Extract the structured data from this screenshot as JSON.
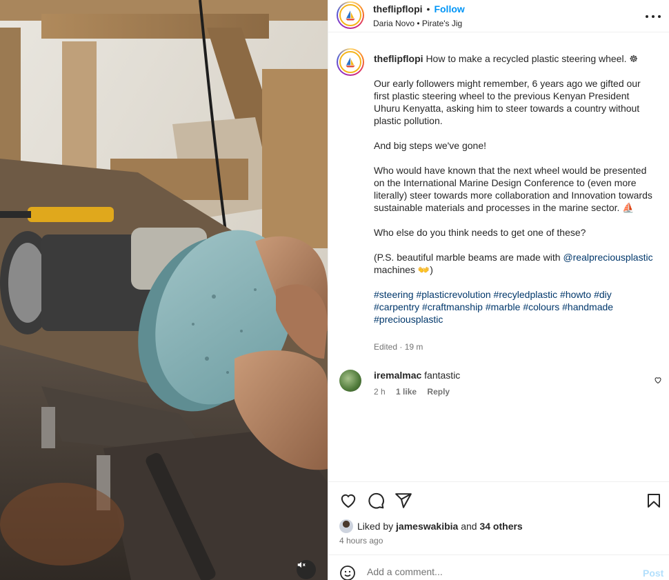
{
  "post": {
    "author": "theflipflopi",
    "follow_label": "Follow",
    "dot": "•",
    "music_artist": "Daria Novo",
    "music_track": "Pirate's Jig",
    "music_sep": "•"
  },
  "caption": {
    "author": "theflipflopi",
    "title": "How to make a recycled plastic steering wheel. ☸",
    "p1": "Our early followers might remember, 6 years ago we gifted our first plastic steering wheel to the previous Kenyan President Uhuru Kenyatta, asking him to steer towards a country without plastic pollution.",
    "p2": "And big steps we've gone!",
    "p3": "Who would have known that the next wheel would be presented on the International Marine Design Conference to (even more literally) steer towards more collaboration and Innovation towards sustainable materials and processes in the marine sector. ⛵",
    "p4": "Who else do you think needs to get one of these?",
    "p5_before": "(P.S. beautiful marble beams are made with ",
    "p5_mention": "@realpreciousplastic",
    "p5_after": " machines 👐)",
    "hashtags": "#steering #plasticrevolution #recyledplastic #howto #diy #carpentry #craftmanship #marble #colours #handmade #preciousplastic",
    "edited": "Edited · 19 m"
  },
  "comment": {
    "user": "iremalmac",
    "text": "fantastic",
    "age": "2 h",
    "likes": "1 like",
    "reply": "Reply"
  },
  "likes": {
    "prefix": "Liked by ",
    "user": "jameswakibia",
    "middle": " and ",
    "others": "34 others"
  },
  "timestamp": "4 hours ago",
  "add_comment": {
    "placeholder": "Add a comment...",
    "post_label": "Post"
  },
  "colors": {
    "accent": "#0095f6",
    "hashtag": "#00376b",
    "muted": "#737373",
    "post_disabled": "#b2dffc"
  }
}
